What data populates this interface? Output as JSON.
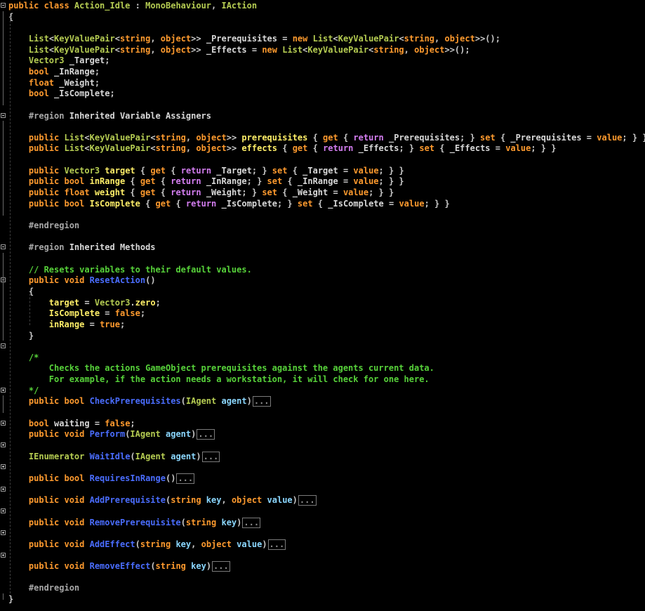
{
  "editor": {
    "language": "csharp",
    "lines": [
      [
        [
          "kw",
          "public class "
        ],
        [
          "ty",
          "Action_Idle"
        ],
        [
          "pc",
          " : "
        ],
        [
          "ty",
          "MonoBehaviour"
        ],
        [
          "pc",
          ", "
        ],
        [
          "ty",
          "IAction"
        ]
      ],
      [
        [
          "pc",
          "{"
        ]
      ],
      [],
      [
        [
          "pc",
          "    "
        ],
        [
          "ty",
          "List"
        ],
        [
          "pc",
          "<"
        ],
        [
          "ty",
          "KeyValuePair"
        ],
        [
          "pc",
          "<"
        ],
        [
          "kw",
          "string"
        ],
        [
          "pc",
          ", "
        ],
        [
          "kw",
          "object"
        ],
        [
          "pc",
          ">> "
        ],
        [
          "nm",
          "_Prerequisites"
        ],
        [
          "pc",
          " = "
        ],
        [
          "kw",
          "new "
        ],
        [
          "ty",
          "List"
        ],
        [
          "pc",
          "<"
        ],
        [
          "ty",
          "KeyValuePair"
        ],
        [
          "pc",
          "<"
        ],
        [
          "kw",
          "string"
        ],
        [
          "pc",
          ", "
        ],
        [
          "kw",
          "object"
        ],
        [
          "pc",
          ">>();"
        ]
      ],
      [
        [
          "pc",
          "    "
        ],
        [
          "ty",
          "List"
        ],
        [
          "pc",
          "<"
        ],
        [
          "ty",
          "KeyValuePair"
        ],
        [
          "pc",
          "<"
        ],
        [
          "kw",
          "string"
        ],
        [
          "pc",
          ", "
        ],
        [
          "kw",
          "object"
        ],
        [
          "pc",
          ">> "
        ],
        [
          "nm",
          "_Effects"
        ],
        [
          "pc",
          " = "
        ],
        [
          "kw",
          "new "
        ],
        [
          "ty",
          "List"
        ],
        [
          "pc",
          "<"
        ],
        [
          "ty",
          "KeyValuePair"
        ],
        [
          "pc",
          "<"
        ],
        [
          "kw",
          "string"
        ],
        [
          "pc",
          ", "
        ],
        [
          "kw",
          "object"
        ],
        [
          "pc",
          ">>();"
        ]
      ],
      [
        [
          "pc",
          "    "
        ],
        [
          "ty",
          "Vector3"
        ],
        [
          "nm",
          " _Target"
        ],
        [
          "pc",
          ";"
        ]
      ],
      [
        [
          "pc",
          "    "
        ],
        [
          "kw",
          "bool"
        ],
        [
          "nm",
          " _InRange"
        ],
        [
          "pc",
          ";"
        ]
      ],
      [
        [
          "pc",
          "    "
        ],
        [
          "kw",
          "float"
        ],
        [
          "nm",
          " _Weight"
        ],
        [
          "pc",
          ";"
        ]
      ],
      [
        [
          "pc",
          "    "
        ],
        [
          "kw",
          "bool"
        ],
        [
          "nm",
          " _IsComplete"
        ],
        [
          "pc",
          ";"
        ]
      ],
      [],
      [
        [
          "pc",
          "    "
        ],
        [
          "pp",
          "#region "
        ],
        [
          "nm",
          "Inherited Variable Assigners"
        ]
      ],
      [],
      [
        [
          "pc",
          "    "
        ],
        [
          "kw",
          "public "
        ],
        [
          "ty",
          "List"
        ],
        [
          "pc",
          "<"
        ],
        [
          "ty",
          "KeyValuePair"
        ],
        [
          "pc",
          "<"
        ],
        [
          "kw",
          "string"
        ],
        [
          "pc",
          ", "
        ],
        [
          "kw",
          "object"
        ],
        [
          "pc",
          ">> "
        ],
        [
          "id",
          "prerequisites"
        ],
        [
          "pc",
          " { "
        ],
        [
          "kw",
          "get"
        ],
        [
          "pc",
          " { "
        ],
        [
          "ret",
          "return"
        ],
        [
          "nm",
          " _Prerequisites"
        ],
        [
          "pc",
          "; } "
        ],
        [
          "kw",
          "set"
        ],
        [
          "pc",
          " { "
        ],
        [
          "nm",
          "_Prerequisites"
        ],
        [
          "pc",
          " = "
        ],
        [
          "kw",
          "value"
        ],
        [
          "pc",
          "; } }"
        ]
      ],
      [
        [
          "pc",
          "    "
        ],
        [
          "kw",
          "public "
        ],
        [
          "ty",
          "List"
        ],
        [
          "pc",
          "<"
        ],
        [
          "ty",
          "KeyValuePair"
        ],
        [
          "pc",
          "<"
        ],
        [
          "kw",
          "string"
        ],
        [
          "pc",
          ", "
        ],
        [
          "kw",
          "object"
        ],
        [
          "pc",
          ">> "
        ],
        [
          "id",
          "effects"
        ],
        [
          "pc",
          " { "
        ],
        [
          "kw",
          "get"
        ],
        [
          "pc",
          " { "
        ],
        [
          "ret",
          "return"
        ],
        [
          "nm",
          " _Effects"
        ],
        [
          "pc",
          "; } "
        ],
        [
          "kw",
          "set"
        ],
        [
          "pc",
          " { "
        ],
        [
          "nm",
          "_Effects"
        ],
        [
          "pc",
          " = "
        ],
        [
          "kw",
          "value"
        ],
        [
          "pc",
          "; } }"
        ]
      ],
      [],
      [
        [
          "pc",
          "    "
        ],
        [
          "kw",
          "public "
        ],
        [
          "ty",
          "Vector3"
        ],
        [
          "pc",
          " "
        ],
        [
          "id",
          "target"
        ],
        [
          "pc",
          " { "
        ],
        [
          "kw",
          "get"
        ],
        [
          "pc",
          " { "
        ],
        [
          "ret",
          "return"
        ],
        [
          "nm",
          " _Target"
        ],
        [
          "pc",
          "; } "
        ],
        [
          "kw",
          "set"
        ],
        [
          "pc",
          " { "
        ],
        [
          "nm",
          "_Target"
        ],
        [
          "pc",
          " = "
        ],
        [
          "kw",
          "value"
        ],
        [
          "pc",
          "; } }"
        ]
      ],
      [
        [
          "pc",
          "    "
        ],
        [
          "kw",
          "public bool "
        ],
        [
          "id",
          "inRange"
        ],
        [
          "pc",
          " { "
        ],
        [
          "kw",
          "get"
        ],
        [
          "pc",
          " { "
        ],
        [
          "ret",
          "return"
        ],
        [
          "nm",
          " _InRange"
        ],
        [
          "pc",
          "; } "
        ],
        [
          "kw",
          "set"
        ],
        [
          "pc",
          " { "
        ],
        [
          "nm",
          "_InRange"
        ],
        [
          "pc",
          " = "
        ],
        [
          "kw",
          "value"
        ],
        [
          "pc",
          "; } }"
        ]
      ],
      [
        [
          "pc",
          "    "
        ],
        [
          "kw",
          "public float "
        ],
        [
          "id",
          "weight"
        ],
        [
          "pc",
          " { "
        ],
        [
          "kw",
          "get"
        ],
        [
          "pc",
          " { "
        ],
        [
          "ret",
          "return"
        ],
        [
          "nm",
          " _Weight"
        ],
        [
          "pc",
          "; } "
        ],
        [
          "kw",
          "set"
        ],
        [
          "pc",
          " { "
        ],
        [
          "nm",
          "_Weight"
        ],
        [
          "pc",
          " = "
        ],
        [
          "kw",
          "value"
        ],
        [
          "pc",
          "; } }"
        ]
      ],
      [
        [
          "pc",
          "    "
        ],
        [
          "kw",
          "public bool "
        ],
        [
          "id",
          "IsComplete"
        ],
        [
          "pc",
          " { "
        ],
        [
          "kw",
          "get"
        ],
        [
          "pc",
          " { "
        ],
        [
          "ret",
          "return"
        ],
        [
          "nm",
          " _IsComplete"
        ],
        [
          "pc",
          "; } "
        ],
        [
          "kw",
          "set"
        ],
        [
          "pc",
          " { "
        ],
        [
          "nm",
          "_IsComplete"
        ],
        [
          "pc",
          " = "
        ],
        [
          "kw",
          "value"
        ],
        [
          "pc",
          "; } }"
        ]
      ],
      [],
      [
        [
          "pc",
          "    "
        ],
        [
          "pp",
          "#endregion"
        ]
      ],
      [],
      [
        [
          "pc",
          "    "
        ],
        [
          "pp",
          "#region "
        ],
        [
          "nm",
          "Inherited Methods"
        ]
      ],
      [],
      [
        [
          "pc",
          "    "
        ],
        [
          "cm",
          "// Resets variables to their default values."
        ]
      ],
      [
        [
          "pc",
          "    "
        ],
        [
          "kw",
          "public void "
        ],
        [
          "fn",
          "ResetAction"
        ],
        [
          "pc",
          "()"
        ]
      ],
      [
        [
          "pc",
          "    {"
        ]
      ],
      [
        [
          "pc",
          "        "
        ],
        [
          "id",
          "target"
        ],
        [
          "pc",
          " = "
        ],
        [
          "ty",
          "Vector3"
        ],
        [
          "pc",
          "."
        ],
        [
          "id",
          "zero"
        ],
        [
          "pc",
          ";"
        ]
      ],
      [
        [
          "pc",
          "        "
        ],
        [
          "id",
          "IsComplete"
        ],
        [
          "pc",
          " = "
        ],
        [
          "lit",
          "false"
        ],
        [
          "pc",
          ";"
        ]
      ],
      [
        [
          "pc",
          "        "
        ],
        [
          "id",
          "inRange"
        ],
        [
          "pc",
          " = "
        ],
        [
          "lit",
          "true"
        ],
        [
          "pc",
          ";"
        ]
      ],
      [
        [
          "pc",
          "    }"
        ]
      ],
      [],
      [
        [
          "pc",
          "    "
        ],
        [
          "cm",
          "/*"
        ]
      ],
      [
        [
          "pc",
          "        "
        ],
        [
          "cm",
          "Checks the actions GameObject prerequisites against the agents current data."
        ]
      ],
      [
        [
          "pc",
          "        "
        ],
        [
          "cm",
          "For example, if the action needs a workstation, it will check for one here."
        ]
      ],
      [
        [
          "pc",
          "    "
        ],
        [
          "cm",
          "*/"
        ]
      ],
      [
        [
          "pc",
          "    "
        ],
        [
          "kw",
          "public bool "
        ],
        [
          "fn",
          "CheckPrerequisites"
        ],
        [
          "pc",
          "("
        ],
        [
          "ty",
          "IAgent"
        ],
        [
          "pm",
          " agent"
        ],
        [
          "pc",
          ")"
        ],
        [
          "col",
          "..."
        ]
      ],
      [],
      [
        [
          "pc",
          "    "
        ],
        [
          "kw",
          "bool"
        ],
        [
          "nm",
          " waiting"
        ],
        [
          "pc",
          " = "
        ],
        [
          "lit",
          "false"
        ],
        [
          "pc",
          ";"
        ]
      ],
      [
        [
          "pc",
          "    "
        ],
        [
          "kw",
          "public void "
        ],
        [
          "fn",
          "Perform"
        ],
        [
          "pc",
          "("
        ],
        [
          "ty",
          "IAgent"
        ],
        [
          "pm",
          " agent"
        ],
        [
          "pc",
          ")"
        ],
        [
          "col",
          "..."
        ]
      ],
      [],
      [
        [
          "pc",
          "    "
        ],
        [
          "ty",
          "IEnumerator"
        ],
        [
          "pc",
          " "
        ],
        [
          "fn",
          "WaitIdle"
        ],
        [
          "pc",
          "("
        ],
        [
          "ty",
          "IAgent"
        ],
        [
          "pm",
          " agent"
        ],
        [
          "pc",
          ")"
        ],
        [
          "col",
          "..."
        ]
      ],
      [],
      [
        [
          "pc",
          "    "
        ],
        [
          "kw",
          "public bool "
        ],
        [
          "fn",
          "RequiresInRange"
        ],
        [
          "pc",
          "()"
        ],
        [
          "col",
          "..."
        ]
      ],
      [],
      [
        [
          "pc",
          "    "
        ],
        [
          "kw",
          "public void "
        ],
        [
          "fn",
          "AddPrerequisite"
        ],
        [
          "pc",
          "("
        ],
        [
          "kw",
          "string"
        ],
        [
          "pm",
          " key"
        ],
        [
          "pc",
          ", "
        ],
        [
          "kw",
          "object"
        ],
        [
          "pm",
          " value"
        ],
        [
          "pc",
          ")"
        ],
        [
          "col",
          "..."
        ]
      ],
      [],
      [
        [
          "pc",
          "    "
        ],
        [
          "kw",
          "public void "
        ],
        [
          "fn",
          "RemovePrerequisite"
        ],
        [
          "pc",
          "("
        ],
        [
          "kw",
          "string"
        ],
        [
          "pm",
          " key"
        ],
        [
          "pc",
          ")"
        ],
        [
          "col",
          "..."
        ]
      ],
      [],
      [
        [
          "pc",
          "    "
        ],
        [
          "kw",
          "public void "
        ],
        [
          "fn",
          "AddEffect"
        ],
        [
          "pc",
          "("
        ],
        [
          "kw",
          "string"
        ],
        [
          "pm",
          " key"
        ],
        [
          "pc",
          ", "
        ],
        [
          "kw",
          "object"
        ],
        [
          "pm",
          " value"
        ],
        [
          "pc",
          ")"
        ],
        [
          "col",
          "..."
        ]
      ],
      [],
      [
        [
          "pc",
          "    "
        ],
        [
          "kw",
          "public void "
        ],
        [
          "fn",
          "RemoveEffect"
        ],
        [
          "pc",
          "("
        ],
        [
          "kw",
          "string"
        ],
        [
          "pm",
          " key"
        ],
        [
          "pc",
          ")"
        ],
        [
          "col",
          "..."
        ]
      ],
      [],
      [
        [
          "pc",
          "    "
        ],
        [
          "pp",
          "#endregion"
        ]
      ],
      [
        [
          "pc",
          "}"
        ]
      ]
    ]
  }
}
